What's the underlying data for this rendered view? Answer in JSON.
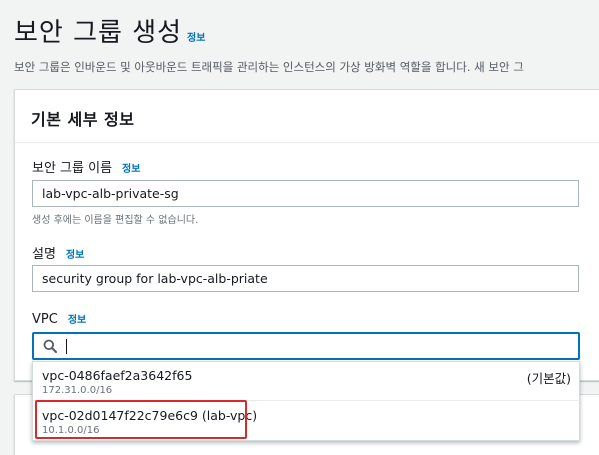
{
  "page": {
    "title": "보안 그룹 생성",
    "info_label": "정보",
    "description": "보안 그룹은 인바운드 및 아웃바운드 트래픽을 관리하는 인스턴스의 가상 방화벽 역할을 합니다. 새 보안 그"
  },
  "basic_details": {
    "title": "기본 세부 정보",
    "name_field": {
      "label": "보안 그룹 이름",
      "info_label": "정보",
      "value": "lab-vpc-alb-private-sg",
      "hint": "생성 후에는 이름을 편집할 수 없습니다."
    },
    "description_field": {
      "label": "설명",
      "info_label": "정보",
      "value": "security group for lab-vpc-alb-priate"
    },
    "vpc_field": {
      "label": "VPC",
      "info_label": "정보",
      "search_value": "",
      "options": [
        {
          "id": "vpc-0486faef2a3642f65",
          "cidr": "172.31.0.0/16",
          "tag": "(기본값)"
        },
        {
          "id": "vpc-02d0147f22c79e6c9 (lab-vpc)",
          "cidr": "10.1.0.0/16",
          "tag": ""
        }
      ]
    }
  },
  "colors": {
    "link": "#0073bb",
    "focus_border": "#0073bb",
    "highlight": "#d62b2b"
  }
}
